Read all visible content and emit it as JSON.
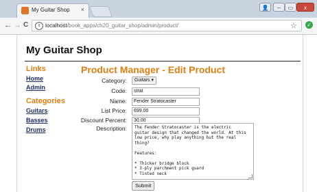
{
  "browser": {
    "tab_title": "My Guitar Shop",
    "tab_close": "×",
    "url_host": "localhost",
    "url_path": "/book_apps/ch20_guitar_shop/admin/product/",
    "back": "←",
    "forward": "→",
    "reload": "C",
    "info": "i",
    "star": "☆",
    "ext": "✓",
    "menu": "⋮",
    "win_min": "–",
    "win_max": "▭",
    "win_close": "x",
    "user_icon": "👤"
  },
  "site": {
    "title": "My Guitar Shop"
  },
  "sidebar": {
    "links_heading": "Links",
    "links": [
      "Home",
      "Admin"
    ],
    "categories_heading": "Categories",
    "categories": [
      "Guitars",
      "Basses",
      "Drums"
    ]
  },
  "main": {
    "heading": "Product Manager - Edit Product",
    "category_label": "Category:",
    "category_value": "Guitars ▾",
    "code_label": "Code:",
    "code_value": "strat",
    "name_label": "Name:",
    "name_value": "Fender Stratocaster",
    "price_label": "List Price:",
    "price_value": "699.00",
    "discount_label": "Discount Percent:",
    "discount_value": "30.00",
    "description_label": "Description:",
    "description_value": "The Fender Stratocaster is the electric\nguitar design that changed the world. At this\nlow price, why play anything but the real\nthing?\n\nFeatures:\n\n* Thicker bridge block\n* 3-ply parchment pick guard\n* Tinted neck",
    "submit_label": "Submit"
  },
  "colors": {
    "accent": "#e07d10",
    "link": "#1d2f6a"
  }
}
